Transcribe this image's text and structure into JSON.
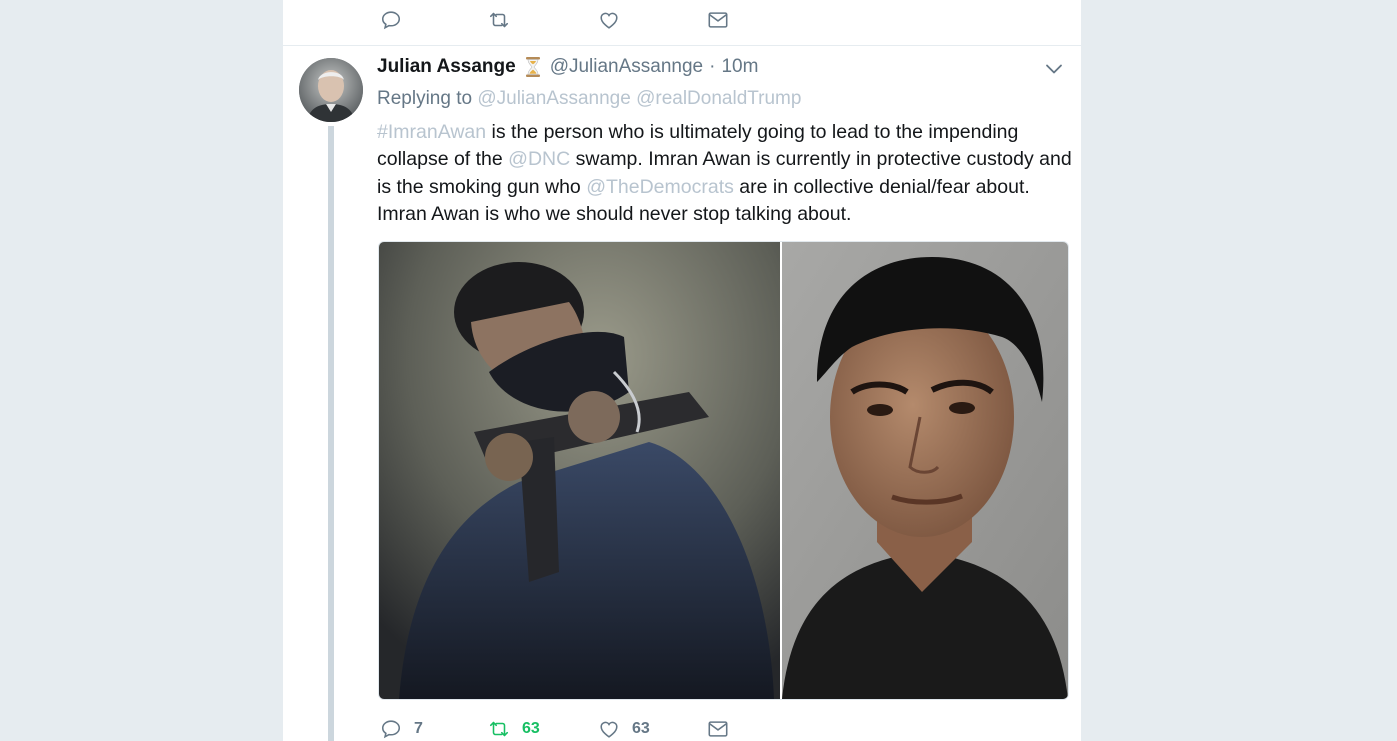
{
  "top_actions": {
    "reply_icon": "reply-icon",
    "retweet_icon": "retweet-icon",
    "like_icon": "heart-icon",
    "message_icon": "envelope-icon"
  },
  "tweet": {
    "author_name": "Julian Assange",
    "author_emoji": "hourglass-icon",
    "handle": "@JulianAssannge",
    "separator": "·",
    "time": "10m",
    "replying_prefix": "Replying to",
    "replying_mentions": [
      "@JulianAssannge",
      "@realDonaldTrump"
    ],
    "text": {
      "hashtag": "#ImranAwan",
      "part1": " is the person who is ultimately going to lead to the impending collapse of the ",
      "mention1": "@DNC",
      "part2": " swamp. Imran Awan is currently in protective custody and is the smoking gun who ",
      "mention2": "@TheDemocrats",
      "part3": " are in collective denial/fear about. Imran Awan is who we should never stop talking about."
    },
    "media": [
      "photo-armed-masked-man",
      "photo-portrait-man"
    ],
    "counts": {
      "replies": "7",
      "retweets": "63",
      "likes": "63"
    }
  },
  "colors": {
    "background": "#e6ecf0",
    "text": "#14171a",
    "secondary": "#657786",
    "link_muted": "#b8c4cf",
    "retweet_green": "#17bf63",
    "thread_line": "#ccd6dd"
  }
}
